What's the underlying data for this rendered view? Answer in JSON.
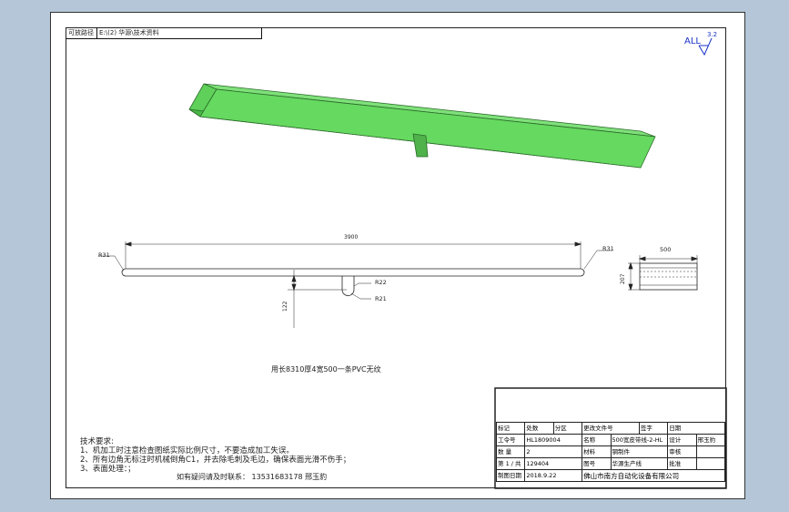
{
  "drawing_path": {
    "label": "可放路径",
    "value": "E:\\(2) 华源\\技术资料"
  },
  "surface_finish": {
    "symbol": "ALL",
    "value": "3.2"
  },
  "dimensions": {
    "length": "3900",
    "r_left": "R31",
    "r_right": "R31",
    "r_mid1": "R22",
    "r_mid2": "R21",
    "height": "122",
    "section_width": "500",
    "section_height": "207"
  },
  "material_note": "用长8310厚4宽500一条PVC无纹",
  "tech_requirements": {
    "title": "技术要求:",
    "lines": [
      "1、机加工时注意检查图纸实际比例尺寸，不要造成加工失误。",
      "2、所有边角无标注时机械倒角C1，并去除毛刺及毛边，确保表面光滑不伤手；",
      "3、表面处理：；"
    ]
  },
  "contact": "如有疑问请及时联系：  13531683178   邢玉豹",
  "title_block": {
    "headers": [
      "标记",
      "处数",
      "分区",
      "更改文件号",
      "签字",
      "日期"
    ],
    "project_label": "工令号",
    "project_value": "HL1809004",
    "part_label": "名称",
    "part_value": "500宽皮带线-2-HL",
    "design_label": "设计",
    "design_value": "邢玉豹",
    "qty_label": "数 量",
    "qty_value": "2",
    "material_label": "材料",
    "material_value": "钢制件",
    "review_label": "审核",
    "page_label": "第 1 / 共",
    "page_value": "129404",
    "drawing_label": "图号",
    "drawing_value": "华源生产线",
    "approve_label": "批准",
    "maker_label": "制图日期",
    "maker_value": "制图日期",
    "scale_label": "比例",
    "scale_value": "2018.9.22",
    "company": "佛山市南方自动化设备有限公司",
    "date": "2018.9.22"
  }
}
